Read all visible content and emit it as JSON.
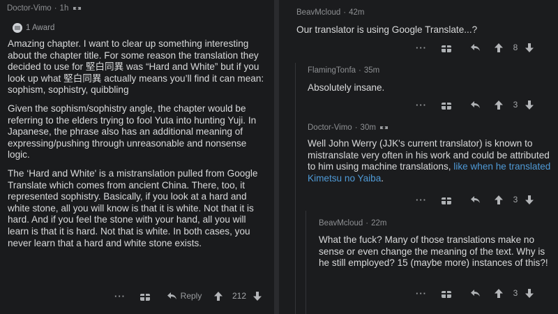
{
  "left": {
    "comment": {
      "user": "Doctor-Vimo",
      "time": "1h",
      "award_label": "1 Award",
      "paragraphs": [
        "Amazing chapter. I want to clear up something interesting about the chapter title. For some reason the translation they decided to use for 堅白同異 was “Hard and White” but if you look up what 堅白同異 actually means you’ll find it can mean: sophism, sophistry, quibbling",
        "Given the sophism/sophistry angle, the chapter would be referring to the elders trying to fool Yuta into hunting Yuji. In Japanese, the phrase also has an additional meaning of expressing/pushing through unreasonable and nonsense logic.",
        "The ‘Hard and White' is a mistranslation pulled from Google Translate which comes from ancient China. There, too, it represented sophistry. Basically, if you look at a hard and white stone, all you will know is that it is white. Not that it is hard. And if you feel the stone with your hand, all you will learn is that it is hard. Not that is white. In both cases, you never learn that a hard and white stone exists."
      ],
      "more": "···",
      "reply_label": "Reply",
      "votes": "212"
    }
  },
  "right": {
    "comments": [
      {
        "user": "BeavMcloud",
        "time": "42m",
        "text": "Our translator is using Google Translate...?",
        "more": "···",
        "votes": "8"
      },
      {
        "user": "FlamingTonfa",
        "time": "35m",
        "text": "Absolutely insane.",
        "more": "···",
        "votes": "3"
      },
      {
        "user": "Doctor-Vimo",
        "time": "30m",
        "text": "Well John Werry (JJK's current translator) is known to mistranslate very often in his work and could be attributed to him using machine translations, ",
        "link": "like when he translated Kimetsu no Yaiba",
        "text_end": ".",
        "more": "···",
        "votes": "3"
      },
      {
        "user": "BeavMcloud",
        "time": "22m",
        "text": "What the fuck? Many of those translations make no sense or even change the meaning of the text. Why is he still employed? 15 (maybe more) instances of this?!",
        "more": "···",
        "votes": "3"
      }
    ]
  },
  "colors": {
    "link": "#4f9ad6",
    "text": "#d9dadb",
    "meta": "#8e9093",
    "background": "#1b1c1e"
  },
  "icons": [
    "gift-icon",
    "reply-arrow-icon",
    "upvote-icon",
    "downvote-icon",
    "award-icon",
    "more-icon"
  ]
}
